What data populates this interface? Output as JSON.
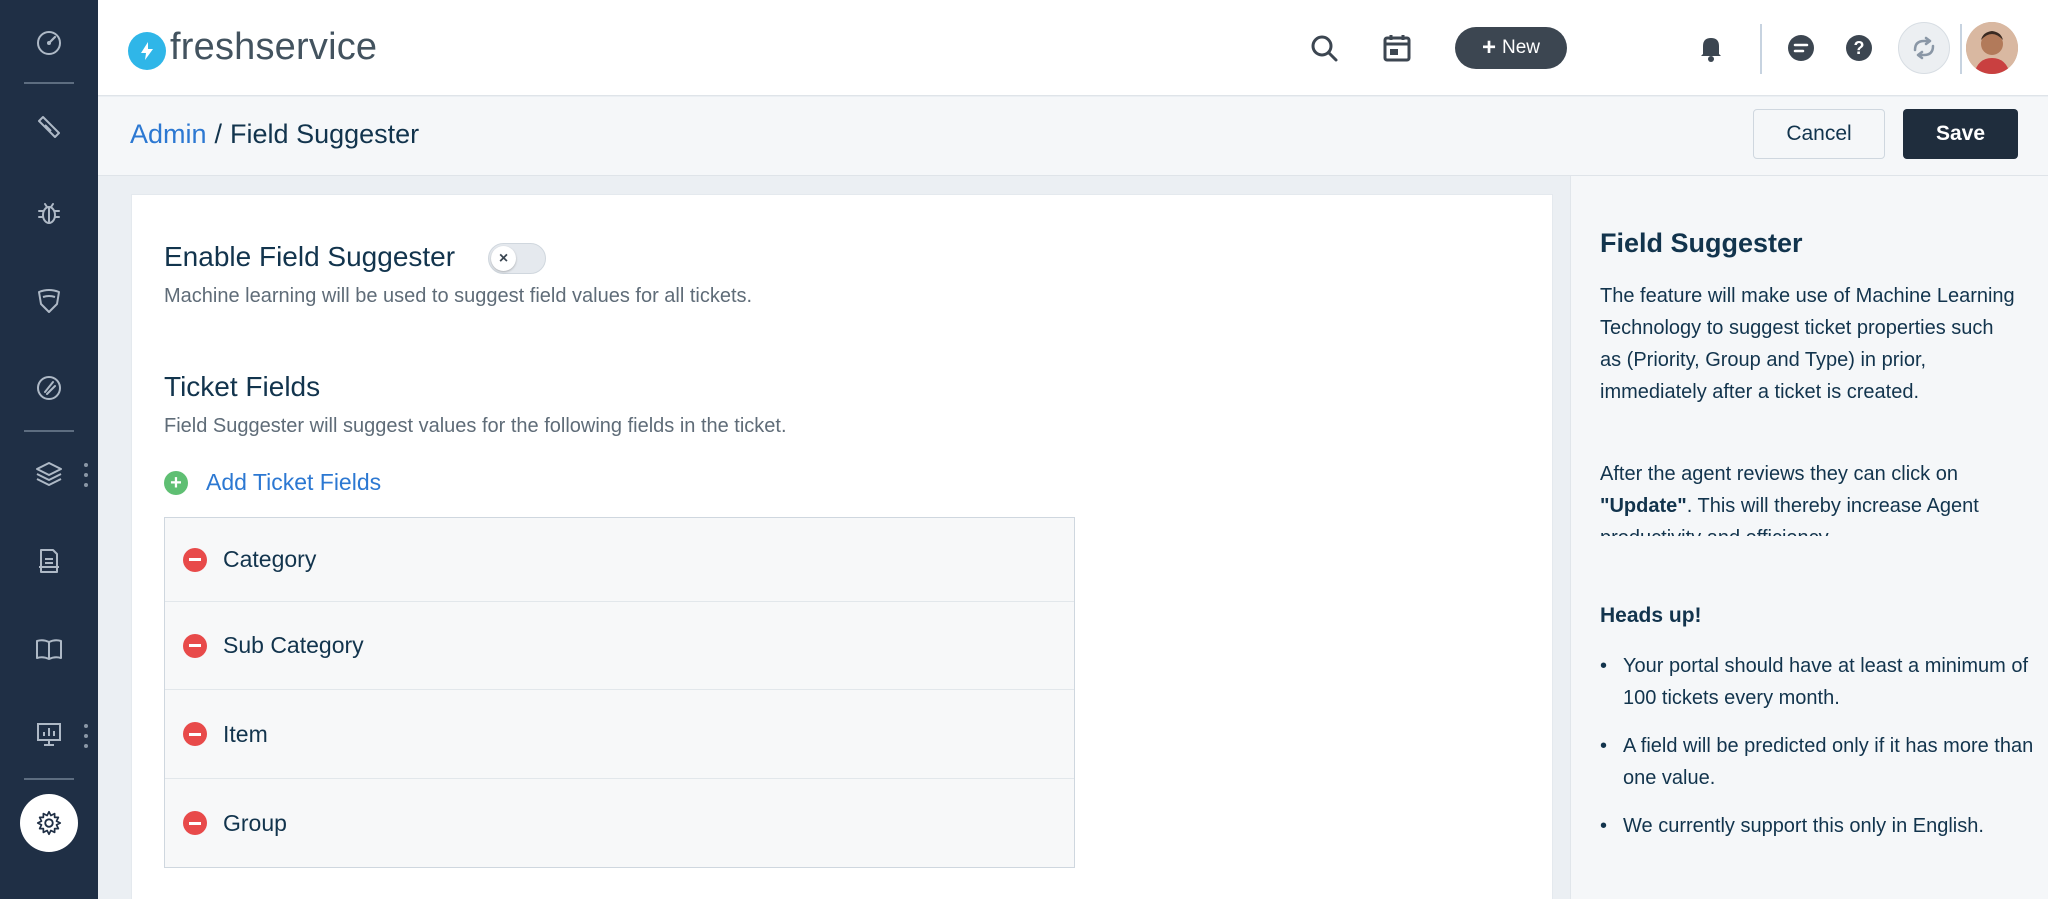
{
  "header": {
    "logo_text": "freshservice",
    "new_button_label": "New"
  },
  "breadcrumb": {
    "parent": "Admin",
    "separator": "/",
    "current": "Field Suggester"
  },
  "actions": {
    "cancel_label": "Cancel",
    "save_label": "Save"
  },
  "enable": {
    "title": "Enable Field Suggester",
    "toggle_on": false,
    "description": "Machine learning will be used to suggest field values for all tickets."
  },
  "ticket_fields": {
    "title": "Ticket Fields",
    "description": "Field Suggester will suggest values for the following fields in the ticket.",
    "add_label": "Add Ticket Fields",
    "items": [
      {
        "label": "Category"
      },
      {
        "label": "Sub Category"
      },
      {
        "label": "Item"
      },
      {
        "label": "Group"
      }
    ]
  },
  "info": {
    "title": "Field Suggester",
    "para1": "The feature will make use of Machine Learning Technology to suggest ticket properties such as (Priority, Group and Type) in prior, immediately after a ticket is created.",
    "para2_prefix": "After the agent reviews they can click on ",
    "para2_bold": "\"Update\"",
    "para2_suffix": ". This will thereby increase Agent productivity and efficiency.",
    "heads_up_title": "Heads up!",
    "heads_up_items": [
      "Your portal should have at least a minimum of 100 tickets every month.",
      "A field will be predicted only if it has more than one value.",
      "We currently support this only in English."
    ]
  },
  "colors": {
    "sidebar_bg": "#1f2f45",
    "link_blue": "#2c78d2",
    "save_bg": "#1f2d3d",
    "add_green": "#5fbf73",
    "remove_red": "#e84a4a",
    "logo_blue": "#2fb6e8"
  },
  "icons": {
    "sidebar": [
      "dashboard-icon",
      "ticket-icon",
      "bug-icon",
      "shield-icon",
      "rocket-icon",
      "layers-icon",
      "inventory-icon",
      "book-icon",
      "analytics-icon",
      "gear-icon"
    ],
    "topbar": [
      "search-icon",
      "calendar-icon",
      "bell-icon",
      "chat-icon",
      "help-icon",
      "info-icon",
      "sync-icon"
    ]
  }
}
